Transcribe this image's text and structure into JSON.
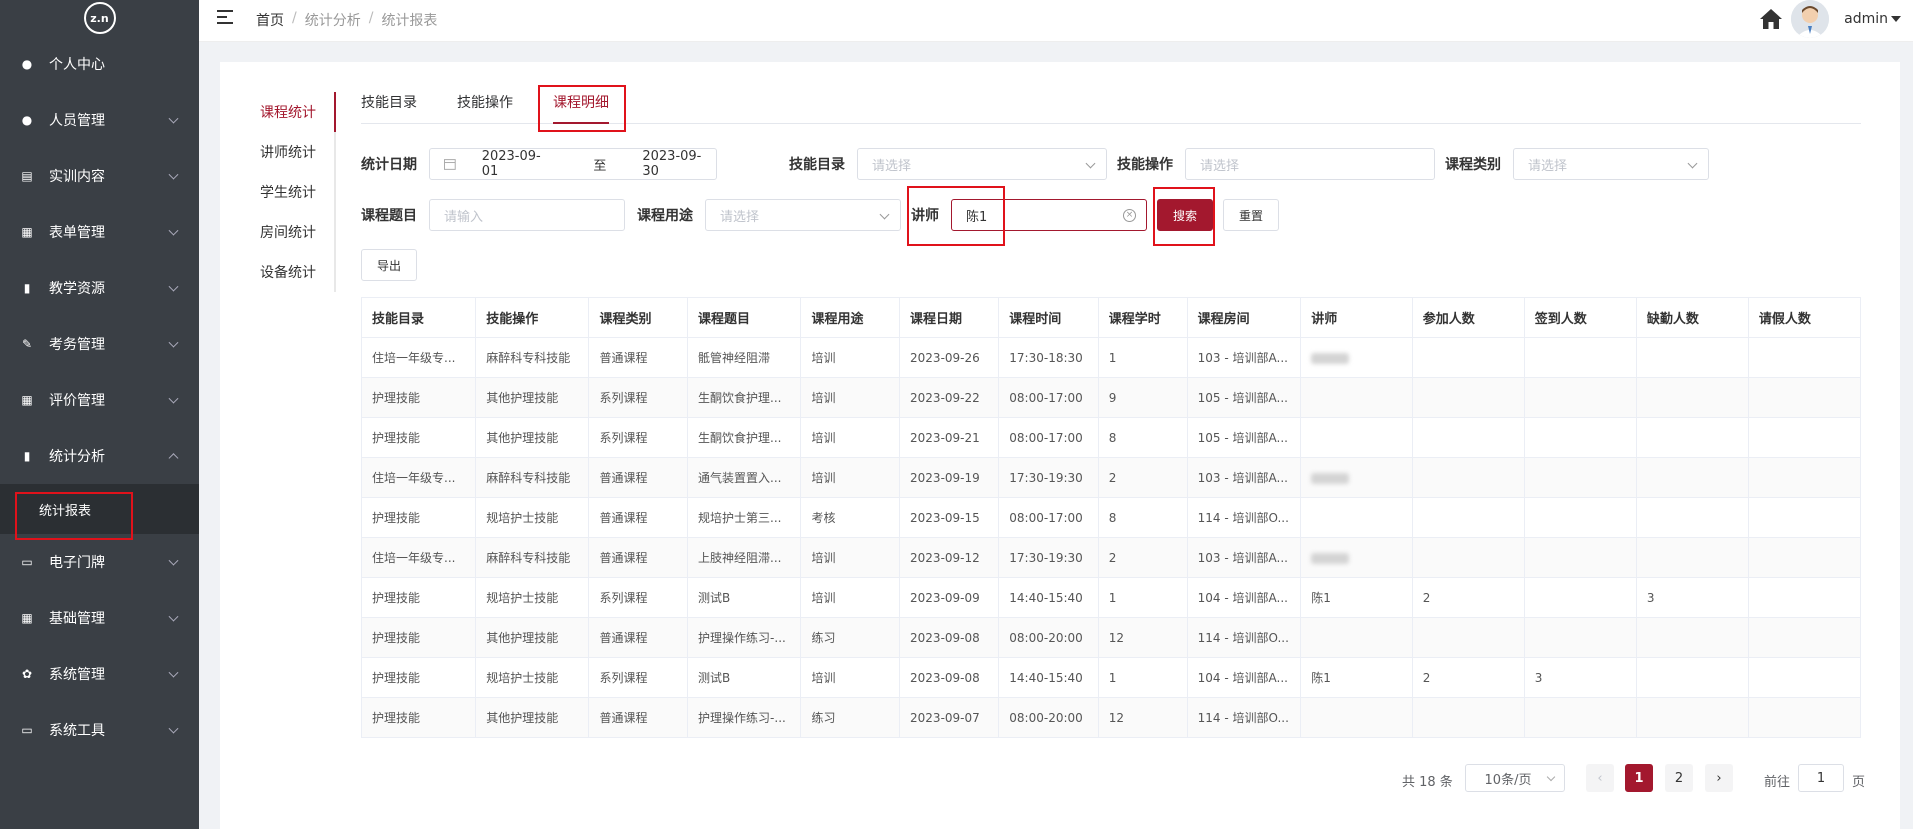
{
  "sidebar": {
    "logo_text": "z.n",
    "items": [
      {
        "label": "个人中心",
        "icon": "user-icon",
        "has_arrow": false
      },
      {
        "label": "人员管理",
        "icon": "users-icon",
        "has_arrow": true
      },
      {
        "label": "实训内容",
        "icon": "training-icon",
        "has_arrow": true
      },
      {
        "label": "表单管理",
        "icon": "form-icon",
        "has_arrow": true
      },
      {
        "label": "教学资源",
        "icon": "book-icon",
        "has_arrow": true
      },
      {
        "label": "考务管理",
        "icon": "edit-icon",
        "has_arrow": true
      },
      {
        "label": "评价管理",
        "icon": "rating-icon",
        "has_arrow": true
      },
      {
        "label": "统计分析",
        "icon": "bar-chart-icon",
        "has_arrow": true,
        "expanded": true
      },
      {
        "label": "电子门牌",
        "icon": "monitor-icon",
        "has_arrow": true
      },
      {
        "label": "基础管理",
        "icon": "grid-icon",
        "has_arrow": true
      },
      {
        "label": "系统管理",
        "icon": "gear-icon",
        "has_arrow": true
      },
      {
        "label": "系统工具",
        "icon": "toolbox-icon",
        "has_arrow": true
      }
    ],
    "submenu_label": "统计报表"
  },
  "header": {
    "breadcrumb": [
      "首页",
      "统计分析",
      "统计报表"
    ],
    "user": "admin"
  },
  "side_tabs": [
    "课程统计",
    "讲师统计",
    "学生统计",
    "房间统计",
    "设备统计"
  ],
  "top_tabs": [
    "技能目录",
    "技能操作",
    "课程明细"
  ],
  "filters": {
    "date_label": "统计日期",
    "date_start": "2023-09-01",
    "date_sep": "至",
    "date_end": "2023-09-30",
    "skill_dir_label": "技能目录",
    "skill_dir_placeholder": "请选择",
    "skill_op_label": "技能操作",
    "skill_op_placeholder": "请选择",
    "course_type_label": "课程类别",
    "course_type_placeholder": "请选择",
    "course_title_label": "课程题目",
    "course_title_placeholder": "请输入",
    "course_use_label": "课程用途",
    "course_use_placeholder": "请选择",
    "lecturer_label": "讲师",
    "lecturer_value": "陈1",
    "search_label": "搜索",
    "reset_label": "重置",
    "export_label": "导出"
  },
  "table": {
    "columns": [
      "技能目录",
      "技能操作",
      "课程类别",
      "课程题目",
      "课程用途",
      "课程日期",
      "课程时间",
      "课程学时",
      "课程房间",
      "讲师",
      "参加人数",
      "签到人数",
      "缺勤人数",
      "请假人数"
    ],
    "rows": [
      [
        "住培一年级专...",
        "麻醉科专科技能",
        "普通课程",
        "骶管神经阻滞",
        "培训",
        "2023-09-26",
        "17:30-18:30",
        "1",
        "103 - 培训部A...",
        "",
        "",
        "",
        "",
        ""
      ],
      [
        "护理技能",
        "其他护理技能",
        "系列课程",
        "生酮饮食护理...",
        "培训",
        "2023-09-22",
        "08:00-17:00",
        "9",
        "105 - 培训部A...",
        "",
        "",
        "",
        "",
        ""
      ],
      [
        "护理技能",
        "其他护理技能",
        "系列课程",
        "生酮饮食护理...",
        "培训",
        "2023-09-21",
        "08:00-17:00",
        "8",
        "105 - 培训部A...",
        "",
        "",
        "",
        "",
        ""
      ],
      [
        "住培一年级专...",
        "麻醉科专科技能",
        "普通课程",
        "通气装置置入...",
        "培训",
        "2023-09-19",
        "17:30-19:30",
        "2",
        "103 - 培训部A...",
        "",
        "",
        "",
        "",
        ""
      ],
      [
        "护理技能",
        "规培护士技能",
        "普通课程",
        "规培护士第三...",
        "考核",
        "2023-09-15",
        "08:00-17:00",
        "8",
        "114 - 培训部O...",
        "",
        "",
        "",
        "",
        ""
      ],
      [
        "住培一年级专...",
        "麻醉科专科技能",
        "普通课程",
        "上肢神经阻滞...",
        "培训",
        "2023-09-12",
        "17:30-19:30",
        "2",
        "103 - 培训部A...",
        "",
        "",
        "",
        "",
        ""
      ],
      [
        "护理技能",
        "规培护士技能",
        "系列课程",
        "测试B",
        "培训",
        "2023-09-09",
        "14:40-15:40",
        "1",
        "104 - 培训部A...",
        "陈1",
        "2",
        "",
        "3",
        ""
      ],
      [
        "护理技能",
        "其他护理技能",
        "普通课程",
        "护理操作练习-...",
        "练习",
        "2023-09-08",
        "08:00-20:00",
        "12",
        "114 - 培训部O...",
        "",
        "",
        "",
        "",
        ""
      ],
      [
        "护理技能",
        "规培护士技能",
        "系列课程",
        "测试B",
        "培训",
        "2023-09-08",
        "14:40-15:40",
        "1",
        "104 - 培训部A...",
        "陈1",
        "2",
        "3",
        "",
        ""
      ],
      [
        "护理技能",
        "其他护理技能",
        "普通课程",
        "护理操作练习-...",
        "练习",
        "2023-09-07",
        "08:00-20:00",
        "12",
        "114 - 培训部O...",
        "",
        "",
        "",
        "",
        ""
      ]
    ],
    "blurred_lecturer_rows": [
      0,
      3,
      5
    ]
  },
  "pagination": {
    "total": "共 18 条",
    "page_size": "10条/页",
    "pages": [
      "1",
      "2"
    ],
    "current": "1",
    "goto_label": "前往",
    "goto_value": "1",
    "page_suffix": "页"
  },
  "colors": {
    "accent": "#a3182e",
    "sidebar": "#3a3f45",
    "highlight": "#e0121b"
  }
}
